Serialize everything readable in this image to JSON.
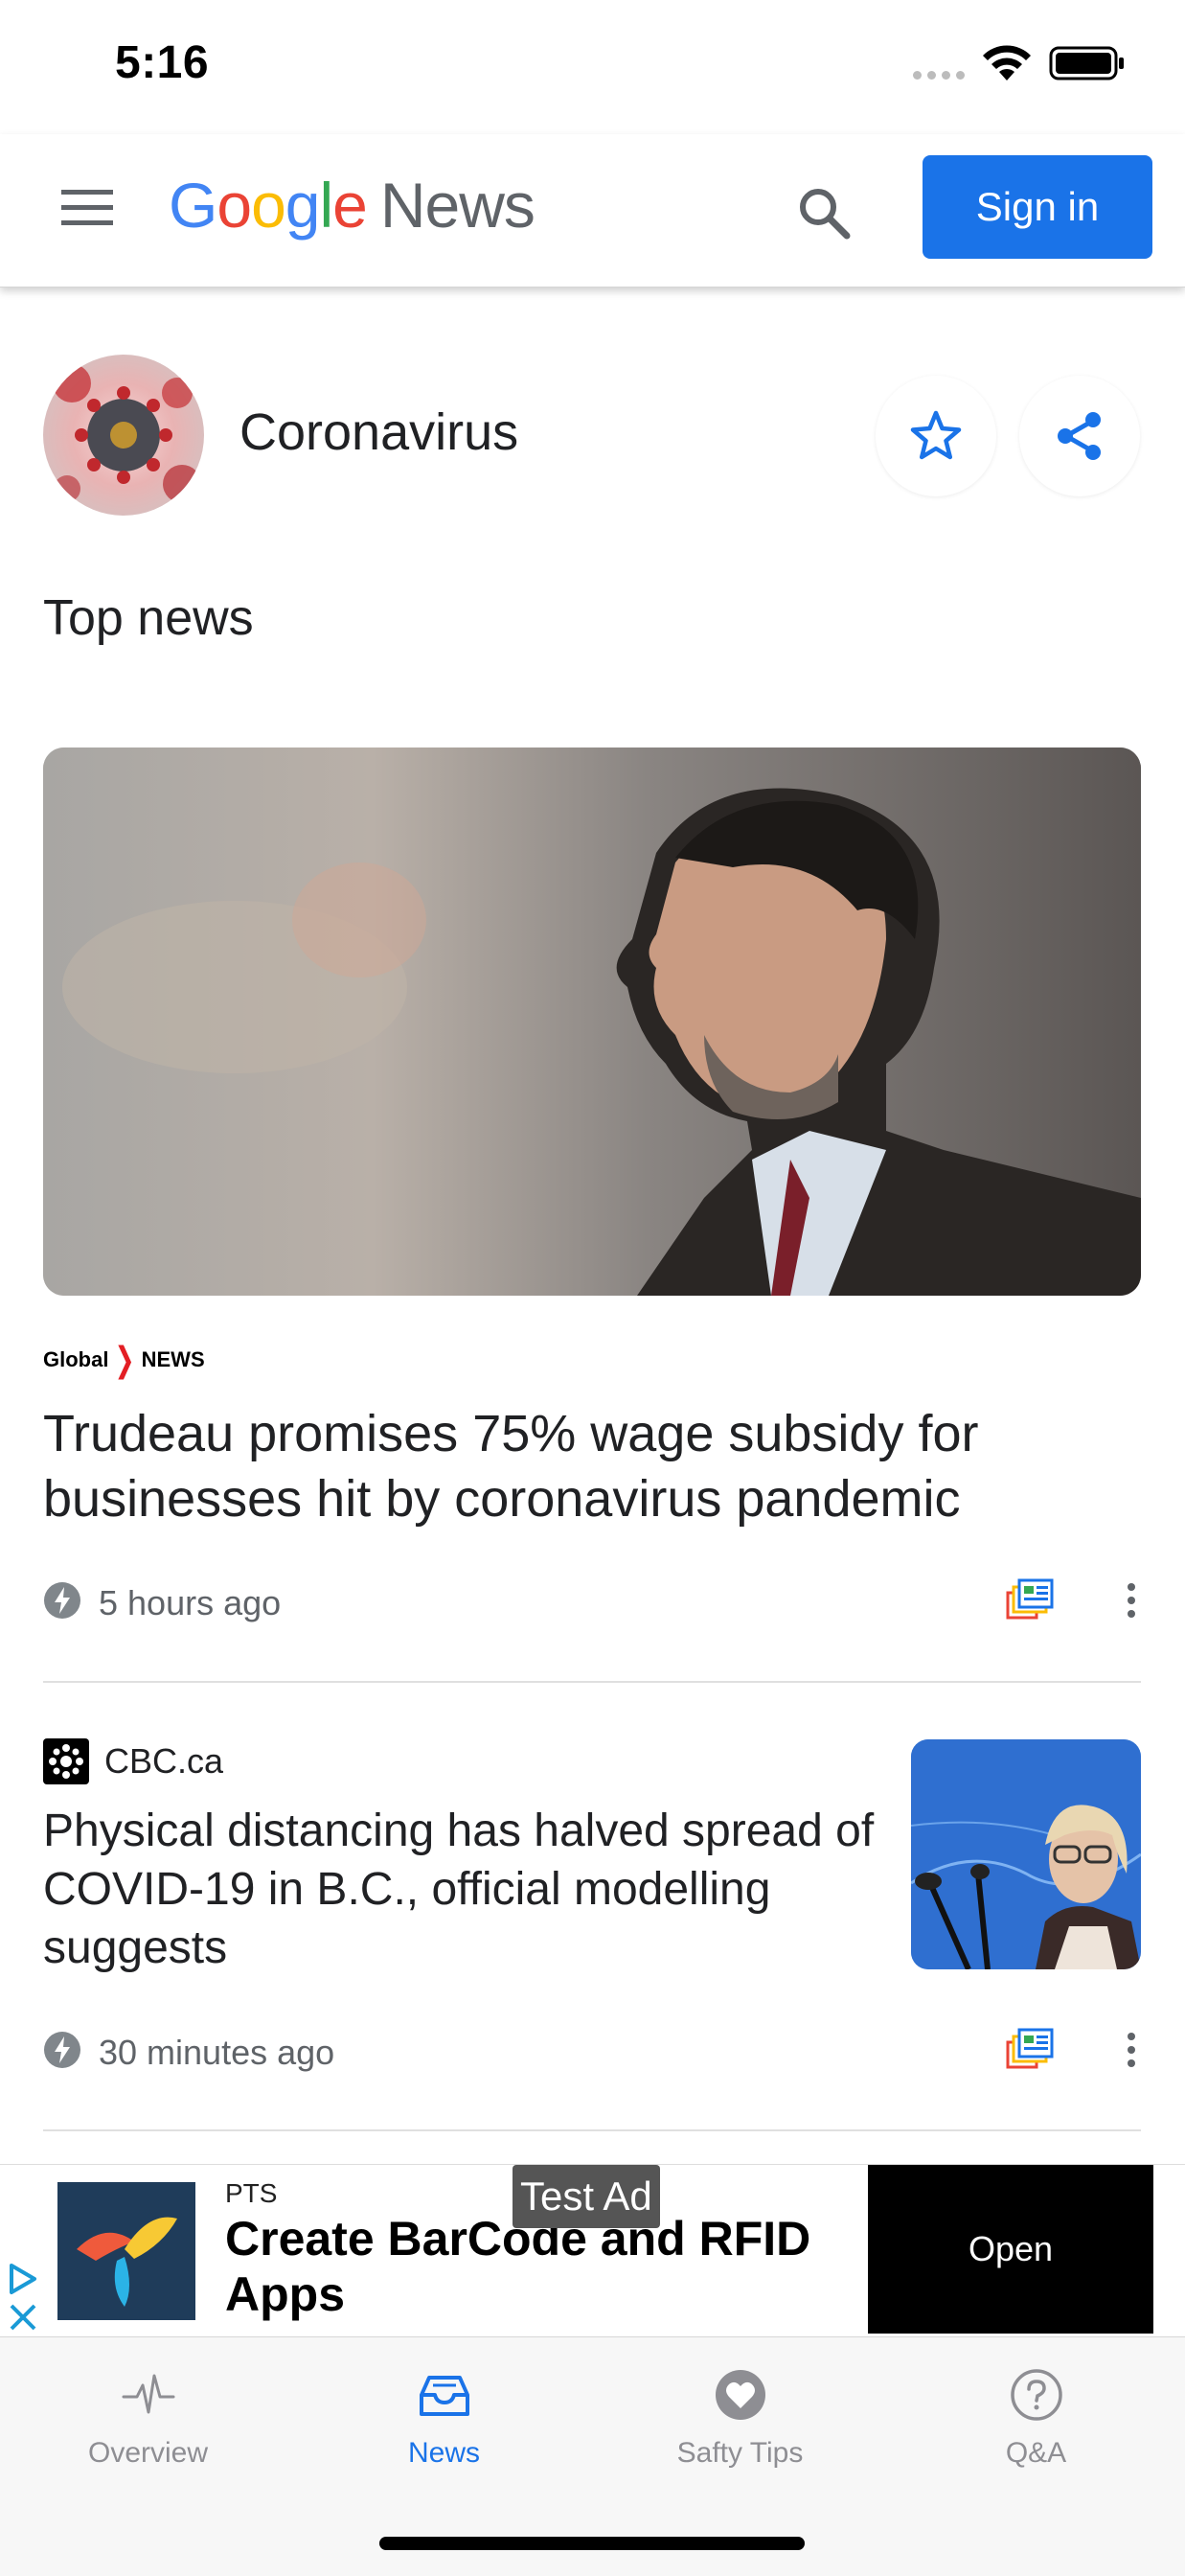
{
  "status_bar": {
    "time": "5:16"
  },
  "header": {
    "logo_google": [
      "G",
      "o",
      "o",
      "g",
      "l",
      "e"
    ],
    "logo_news": "News",
    "sign_in_label": "Sign in"
  },
  "topic": {
    "title": "Coronavirus"
  },
  "section": {
    "title": "Top news"
  },
  "hero_story": {
    "publisher": "Global NEWS",
    "headline": "Trudeau promises 75% wage subsidy for businesses hit by coronavirus pandemic",
    "time": "5 hours ago"
  },
  "second_story": {
    "source": "CBC.ca",
    "headline": "Physical distancing has halved spread of COVID-19 in B.C., official modelling suggests",
    "time": "30 minutes ago"
  },
  "ad": {
    "advertiser": "PTS",
    "headline": "Create BarCode and RFID Apps",
    "label": "Test Ad",
    "cta": "Open"
  },
  "tabs": [
    {
      "label": "Overview",
      "icon": "pulse-icon"
    },
    {
      "label": "News",
      "icon": "inbox-icon",
      "active": true
    },
    {
      "label": "Safty Tips",
      "icon": "heart-icon"
    },
    {
      "label": "Q&A",
      "icon": "question-icon"
    }
  ],
  "colors": {
    "accent": "#1a73e8",
    "google_blue": "#4285F4",
    "google_red": "#EA4335",
    "google_yellow": "#FBBC05",
    "google_green": "#34A853",
    "tab_inactive": "#8e8e93"
  }
}
